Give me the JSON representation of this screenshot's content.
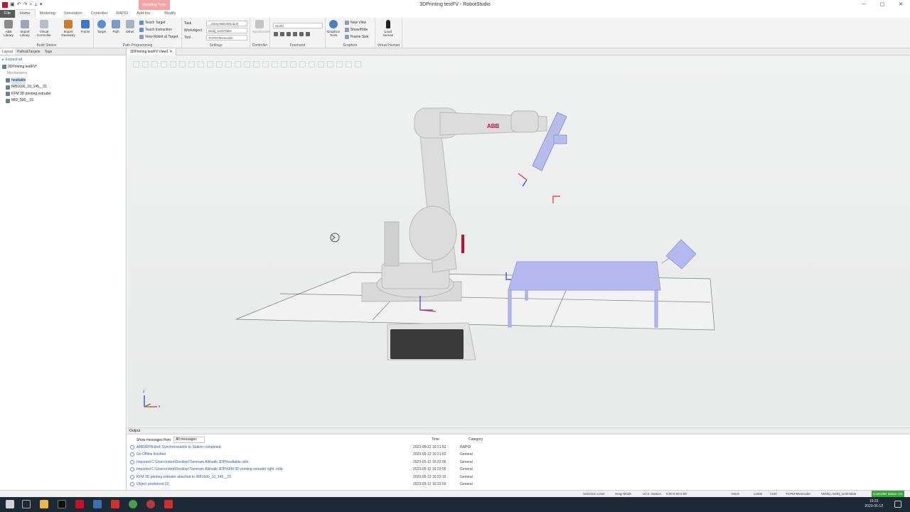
{
  "window": {
    "title": "3DPrinting testFV - RobotStudio",
    "context_tab": "Modeling Tools",
    "min": "─",
    "max": "▢",
    "close": "✕"
  },
  "tabs": [
    "File",
    "Home",
    "Modeling",
    "Simulation",
    "Controller",
    "RAPID",
    "Add-Ins",
    "Modify"
  ],
  "ribbon": {
    "build_station": {
      "label": "Build Station",
      "buttons": [
        "ABB Library",
        "Import Library",
        "Virtual Controller",
        "Import Geometry",
        "Frame"
      ]
    },
    "path_programming": {
      "label": "Path Programming",
      "buttons": [
        "Target",
        "Path",
        "Other"
      ],
      "small": [
        "Teach Target",
        "Teach Instruction",
        "View Robot at Target"
      ]
    },
    "settings": {
      "label": "Settings",
      "fields": [
        "Task",
        "Workobject",
        "Tool"
      ],
      "values": [
        "...OB1(ABB3DRobot)",
        "Wobj_workTable",
        "TCPKFMextruder"
      ]
    },
    "controller": {
      "label": "Controller",
      "button": "Synchronize"
    },
    "freehand": {
      "label": "Freehand",
      "value": "World"
    },
    "graphics": {
      "label": "Graphics",
      "button": "Graphics Tools",
      "small": [
        "New View",
        "Show/Hide",
        "Frame Size"
      ]
    },
    "virtual_human": {
      "label": "Virtual Human",
      "button": "Load Human"
    }
  },
  "layout_panel": {
    "tabs": [
      "Layout",
      "Paths&Targets",
      "Tags"
    ],
    "expand": "Expand all",
    "station": "3DPrinting testFV*",
    "header": "Mechanisms",
    "items": [
      "healtable",
      "IRB1600_10_145__01",
      "KFM 3D printing extruder",
      "MID_500__01"
    ]
  },
  "view_tab": "3DPrinting testFV:View1",
  "axes": {
    "x": "x",
    "z": "z"
  },
  "output": {
    "title": "Output",
    "filter_label": "Show messages from",
    "filter_value": "All messages",
    "col_time": "Time",
    "col_category": "Category",
    "rows": [
      {
        "msg": "ABB3DPRobot: Synchronization to Station completed.",
        "time": "2023-05-12 16:21:52",
        "cat": "RAPID"
      },
      {
        "msg": "Go Offline finished",
        "time": "2023-05-12 16:21:52",
        "cat": "General"
      },
      {
        "msg": "Imported C:\\Users\\robot\\Desktop\\Tammam Alkhatib 3DP\\healtable.rslib",
        "time": "2023-05-12 16:22:05",
        "cat": "General"
      },
      {
        "msg": "Imported C:\\Users\\robot\\Desktop\\Tammam Alkhatib 3DP\\KFM 3D printing extruder right .rslib",
        "time": "2023-05-12 16:22:05",
        "cat": "General"
      },
      {
        "msg": "KFM 3D printing extruder attached to IRB1600_10_145__01",
        "time": "2023-05-12 16:22:15",
        "cat": "General"
      },
      {
        "msg": "Object positioned [3]",
        "time": "2023-05-12 16:22:59",
        "cat": "General"
      }
    ]
  },
  "statusbar": {
    "selection": "Selection Level",
    "snap": "Snap Mode",
    "ucs": "UCS: Station",
    "coords": "0.00  0.00  0.00",
    "move": "Move",
    "speed": "v1000",
    "zone": "z100",
    "tool": "TCPKFMextruder",
    "wobj": "\\WObj:=Wobj_workTable",
    "controller": "Controller status: 1/1"
  },
  "clock": {
    "time": "16:23",
    "date": "2023-05-12"
  }
}
